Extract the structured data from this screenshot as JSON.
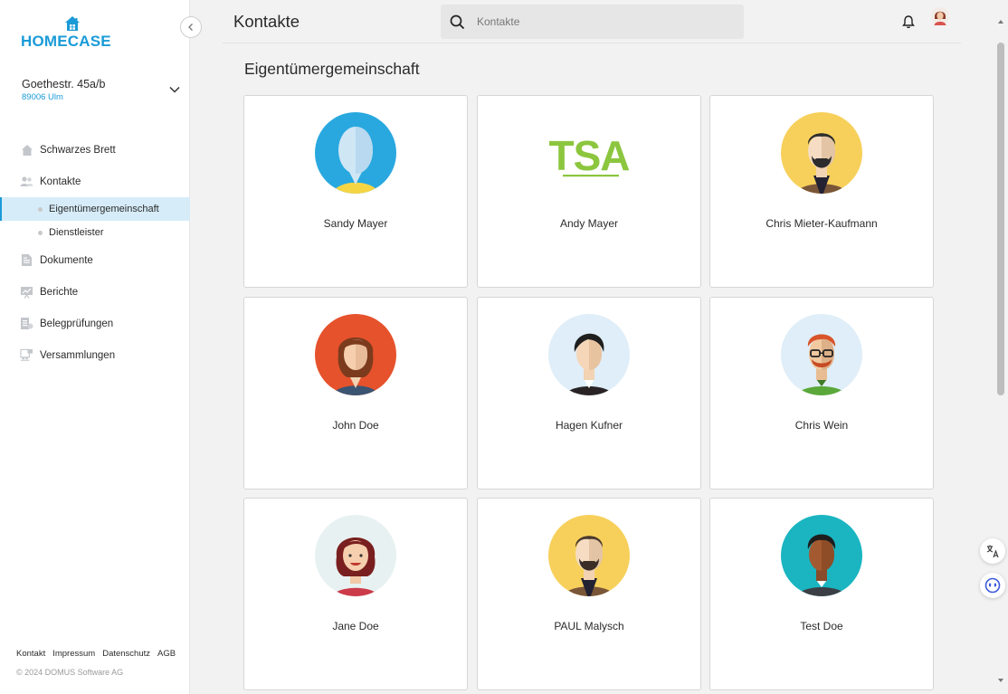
{
  "brand": {
    "name": "HOMECASE",
    "color": "#1a9bd7"
  },
  "property": {
    "street": "Goethestr. 45a/b",
    "city": "89006 Ulm"
  },
  "nav": {
    "items": [
      {
        "label": "Schwarzes Brett",
        "icon": "house-icon"
      },
      {
        "label": "Kontakte",
        "icon": "contacts-icon"
      },
      {
        "label": "Dokumente",
        "icon": "document-icon"
      },
      {
        "label": "Berichte",
        "icon": "report-chart-icon"
      },
      {
        "label": "Belegprüfungen",
        "icon": "receipt-check-icon"
      },
      {
        "label": "Versammlungen",
        "icon": "meeting-icon"
      }
    ],
    "sub": [
      {
        "label": "Eigentümergemeinschaft",
        "active": true
      },
      {
        "label": "Dienstleister",
        "active": false
      }
    ]
  },
  "footer": {
    "links": [
      "Kontakt",
      "Impressum",
      "Datenschutz",
      "AGB"
    ],
    "copyright": "© 2024 DOMUS Software AG"
  },
  "header": {
    "title": "Kontakte",
    "search_placeholder": "Kontakte"
  },
  "section": {
    "title": "Eigentümergemeinschaft"
  },
  "contacts": [
    {
      "name": "Sandy Mayer",
      "avatar": "default-avatar-icon"
    },
    {
      "name": "Andy Mayer",
      "avatar": "tsa-logo"
    },
    {
      "name": "Chris Mieter-Kaufmann",
      "avatar": "bearded-man-avatar"
    },
    {
      "name": "John Doe",
      "avatar": "woman-brown-hair-avatar"
    },
    {
      "name": "Hagen Kufner",
      "avatar": "man-black-hair-avatar"
    },
    {
      "name": "Chris Wein",
      "avatar": "man-glasses-avatar"
    },
    {
      "name": "Jane Doe",
      "avatar": "woman-smiling-avatar"
    },
    {
      "name": "PAUL Malysch",
      "avatar": "bearded-man-avatar"
    },
    {
      "name": "Test Doe",
      "avatar": "man-dark-skin-avatar"
    }
  ],
  "logo_text": {
    "tsa": "TSA"
  }
}
